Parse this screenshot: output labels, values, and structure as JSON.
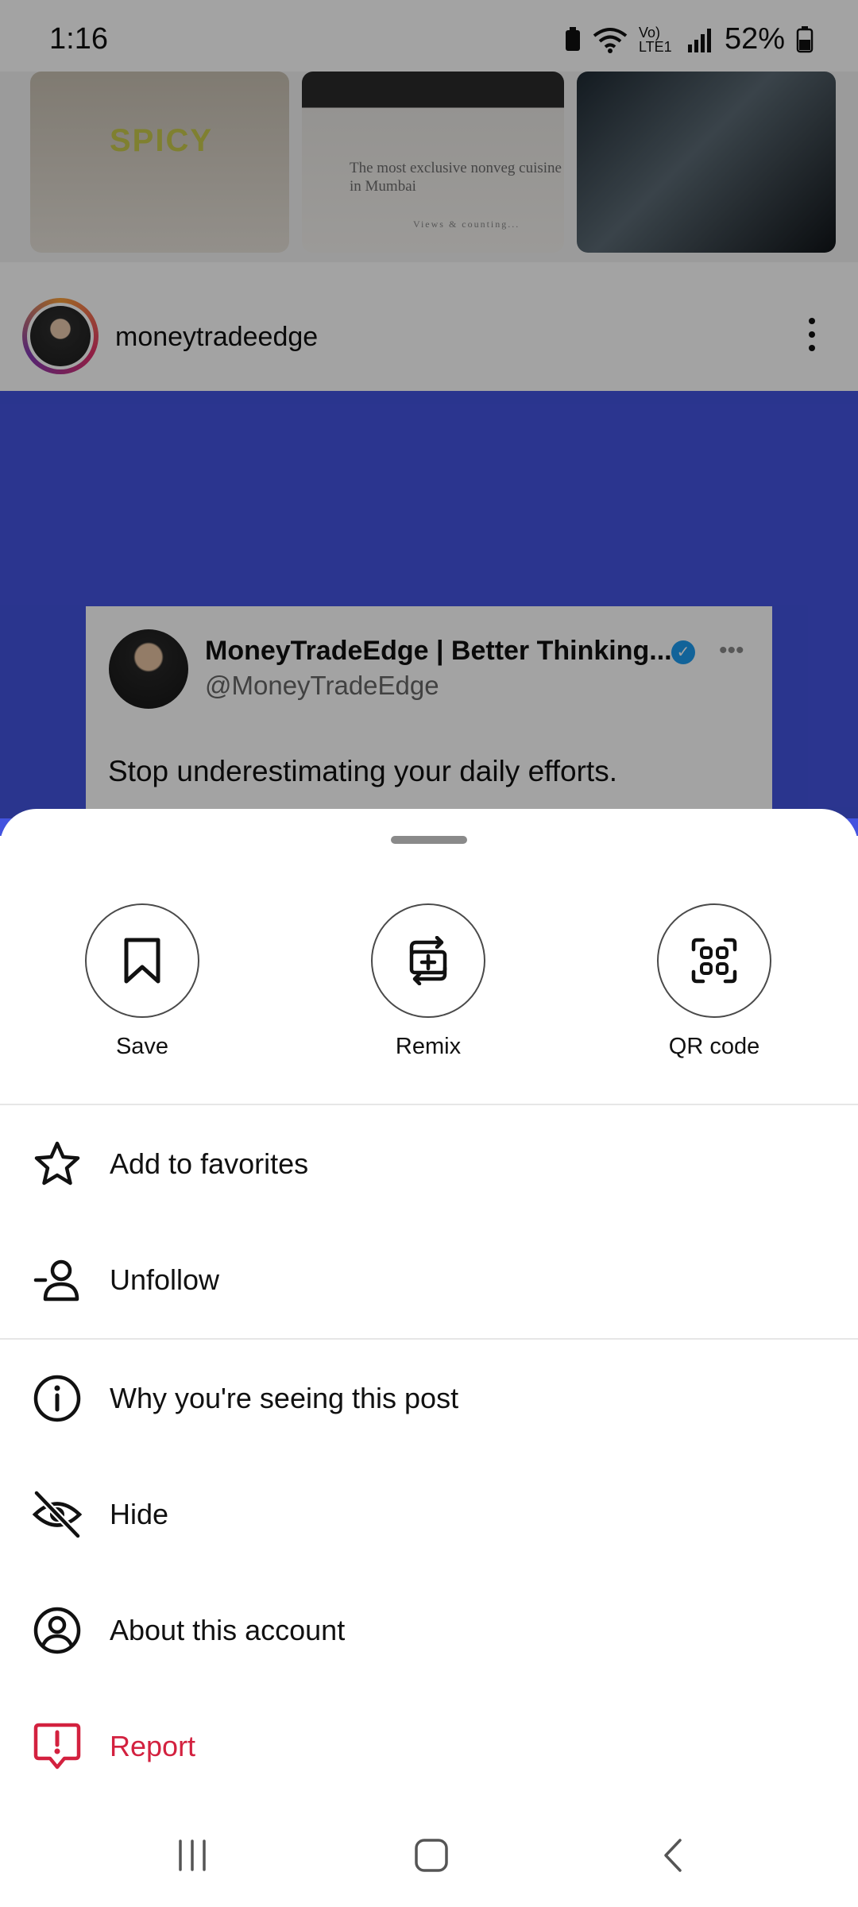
{
  "status_bar": {
    "time": "1:16",
    "battery": "52%",
    "network": "Vo) LTE1"
  },
  "feed": {
    "thumb1_text": "SPICY",
    "thumb2_text": "The most exclusive nonveg cuisine in Mumbai",
    "thumb2_small": "Views & counting...",
    "post_username": "moneytradeedge",
    "tweet_name": "MoneyTradeEdge | Better Thinking...",
    "tweet_handle": "@MoneyTradeEdge",
    "tweet_text": "Stop underestimating your daily efforts."
  },
  "sheet": {
    "actions": [
      {
        "label": "Save",
        "icon": "bookmark-icon"
      },
      {
        "label": "Remix",
        "icon": "remix-icon"
      },
      {
        "label": "QR code",
        "icon": "qr-code-icon"
      }
    ],
    "menu": [
      {
        "label": "Add to favorites",
        "icon": "star-icon"
      },
      {
        "label": "Unfollow",
        "icon": "unfollow-icon"
      },
      {
        "label": "Why you're seeing this post",
        "icon": "info-icon"
      },
      {
        "label": "Hide",
        "icon": "eye-off-icon"
      },
      {
        "label": "About this account",
        "icon": "account-circle-icon"
      },
      {
        "label": "Report",
        "icon": "report-icon"
      }
    ]
  },
  "colors": {
    "post_background": "#4353df",
    "report": "#d3213f",
    "verified": "#1d9bf0"
  }
}
